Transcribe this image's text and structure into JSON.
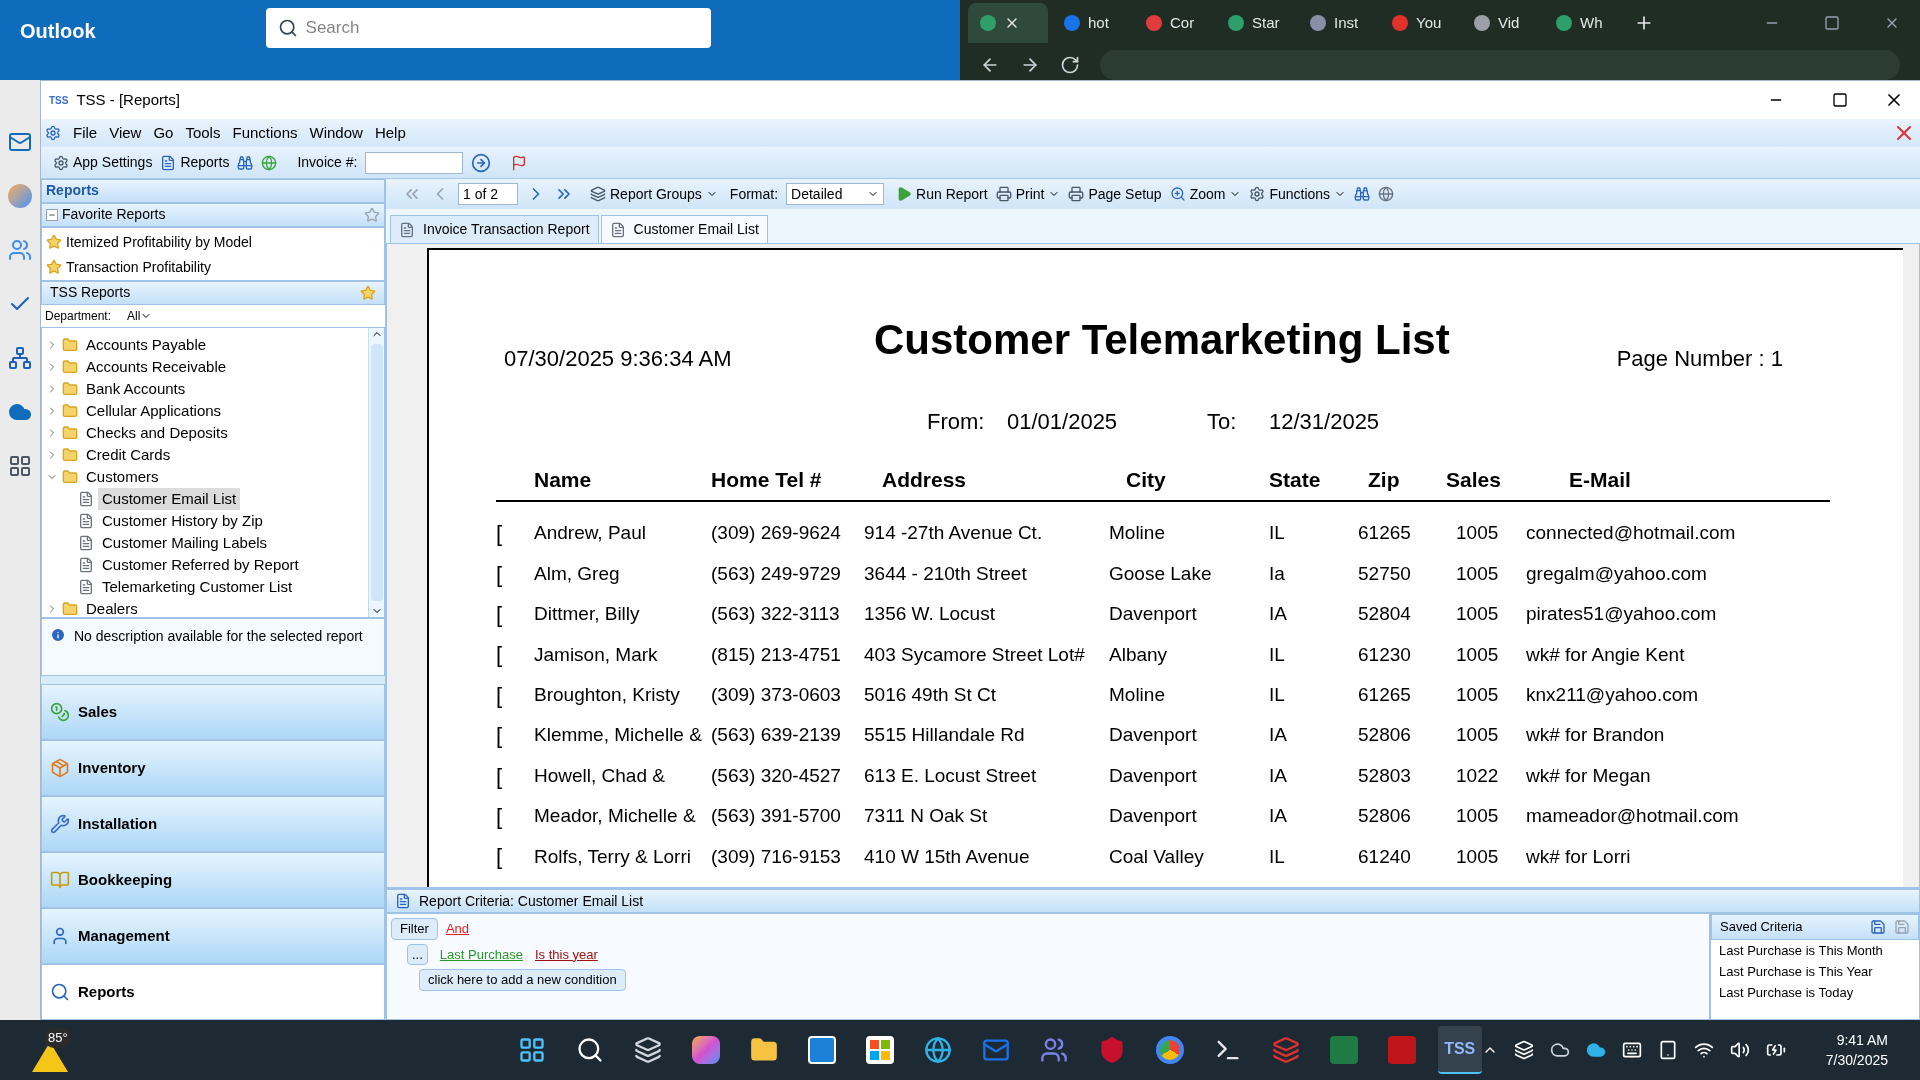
{
  "outlook": {
    "app_name": "Outlook",
    "search_placeholder": "Search"
  },
  "browser": {
    "tabs": [
      {
        "selected": true,
        "color": "#2e9e6b"
      },
      {
        "label": "hot",
        "selected": false,
        "color": "#1a73e8"
      },
      {
        "label": "Cor",
        "selected": false,
        "color": "#e03c3c"
      },
      {
        "label": "Star",
        "selected": false,
        "color": "#2e9e6b"
      },
      {
        "label": "Inst",
        "selected": false,
        "color": "#8a8fa8"
      },
      {
        "label": "You",
        "selected": false,
        "color": "#e0312b"
      },
      {
        "label": "Vid",
        "selected": false,
        "color": "#9aa0a6"
      },
      {
        "label": "Wh",
        "selected": false,
        "color": "#2e9e6b"
      }
    ]
  },
  "window": {
    "title": "TSS - [Reports]",
    "icon_text": "TSS"
  },
  "menu": [
    {
      "label": "File",
      "selected": false
    },
    {
      "label": "View",
      "selected": false
    },
    {
      "label": "Go",
      "selected": false
    },
    {
      "label": "Tools",
      "selected": false
    },
    {
      "label": "Functions",
      "selected": false
    },
    {
      "label": "Window",
      "selected": false
    },
    {
      "label": "Help",
      "selected": false
    }
  ],
  "toolbar": {
    "app_settings": "App Settings",
    "reports": "Reports",
    "invoice_label": "Invoice #:"
  },
  "report_toolbar": {
    "nav": [
      {
        "kind": "first",
        "disabled": true
      },
      {
        "kind": "prev",
        "disabled": true
      },
      {
        "kind": "page",
        "text": "1 of 2",
        "disabled": false
      },
      {
        "kind": "next",
        "disabled": false
      },
      {
        "kind": "last",
        "disabled": false
      }
    ],
    "report_groups": "Report Groups",
    "format_label": "Format:",
    "format_value": "Detailed",
    "run": "Run Report",
    "print": "Print",
    "page_setup": "Page Setup",
    "zoom": "Zoom",
    "functions": "Functions"
  },
  "tabs": [
    {
      "label": "Invoice Transaction Report",
      "selected": false
    },
    {
      "label": "Customer Email List",
      "selected": true
    }
  ],
  "sidebar": {
    "title": "Reports",
    "favorites_title": "Favorite Reports",
    "favorites_expanded": true,
    "favorites": [
      "Itemized Profitability by Model",
      "Transaction Profitability"
    ],
    "tss_title": "TSS Reports",
    "department_label": "Department:",
    "department_value": "All",
    "tree": [
      {
        "label": "Accounts Payable",
        "kind": "folder",
        "expanded": false,
        "selected": false
      },
      {
        "label": "Accounts Receivable",
        "kind": "folder",
        "expanded": false,
        "selected": false
      },
      {
        "label": "Bank Accounts",
        "kind": "folder",
        "expanded": false,
        "selected": false
      },
      {
        "label": "Cellular Applications",
        "kind": "folder",
        "expanded": false,
        "selected": false
      },
      {
        "label": "Checks and Deposits",
        "kind": "folder",
        "expanded": false,
        "selected": false
      },
      {
        "label": "Credit Cards",
        "kind": "folder",
        "expanded": false,
        "selected": false
      },
      {
        "label": "Customers",
        "kind": "folder",
        "expanded": true,
        "selected": false,
        "children": [
          {
            "label": "Customer Email List",
            "kind": "report",
            "selected": true
          },
          {
            "label": "Customer History by Zip",
            "kind": "report",
            "selected": false
          },
          {
            "label": "Customer Mailing Labels",
            "kind": "report",
            "selected": false
          },
          {
            "label": "Customer Referred by Report",
            "kind": "report",
            "selected": false
          },
          {
            "label": "Telemarketing Customer List",
            "kind": "report",
            "selected": false
          }
        ]
      },
      {
        "label": "Dealers",
        "kind": "folder",
        "expanded": false,
        "selected": false
      }
    ],
    "description": "No description available for the selected report",
    "nav": [
      {
        "label": "Sales",
        "kind": "sales",
        "selected": false
      },
      {
        "label": "Inventory",
        "kind": "inventory",
        "selected": false
      },
      {
        "label": "Installation",
        "kind": "installation",
        "selected": false
      },
      {
        "label": "Bookkeeping",
        "kind": "bookkeeping",
        "selected": false
      },
      {
        "label": "Management",
        "kind": "management",
        "selected": false
      },
      {
        "label": "Reports",
        "kind": "reports",
        "selected": true
      }
    ]
  },
  "report": {
    "printed_at": "07/30/2025 9:36:34 AM",
    "title": "Customer Telemarketing List",
    "page_number": "Page Number : 1",
    "from_label": "From:",
    "from": "01/01/2025",
    "to_label": "To:",
    "to": "12/31/2025",
    "columns": [
      "Name",
      "Home Tel #",
      "Address",
      "City",
      "State",
      "Zip",
      "Sales",
      "E-Mail"
    ],
    "rows": [
      {
        "mark": "[",
        "cells": [
          "Andrew, Paul",
          "(309) 269-9624",
          "914 -27th Avenue Ct.",
          "Moline",
          "IL",
          "61265",
          "1005",
          "connected@hotmail.com"
        ]
      },
      {
        "mark": "[",
        "cells": [
          "Alm, Greg",
          "(563) 249-9729",
          "3644 - 210th Street",
          "Goose Lake",
          "Ia",
          "52750",
          "1005",
          "gregalm@yahoo.com"
        ]
      },
      {
        "mark": "[",
        "cells": [
          "Dittmer, Billy",
          "(563) 322-3113",
          "1356 W. Locust",
          "Davenport",
          "IA",
          "52804",
          "1005",
          "pirates51@yahoo.com"
        ]
      },
      {
        "mark": "[",
        "cells": [
          "Jamison, Mark",
          "(815) 213-4751",
          "403 Sycamore Street Lot#",
          "Albany",
          "IL",
          "61230",
          "1005",
          "wk# for Angie Kent"
        ]
      },
      {
        "mark": "[",
        "cells": [
          "Broughton, Kristy",
          "(309) 373-0603",
          "5016 49th St Ct",
          "Moline",
          "IL",
          "61265",
          "1005",
          "knx211@yahoo.com"
        ]
      },
      {
        "mark": "[",
        "cells": [
          "Klemme, Michelle &",
          "(563) 639-2139",
          "5515 Hillandale Rd",
          "Davenport",
          "IA",
          "52806",
          "1005",
          "wk# for Brandon"
        ]
      },
      {
        "mark": "[",
        "cells": [
          "Howell, Chad &",
          "(563) 320-4527",
          "613 E. Locust Street",
          "Davenport",
          "IA",
          "52803",
          "1022",
          "wk# for Megan"
        ]
      },
      {
        "mark": "[",
        "cells": [
          "Meador, Michelle &",
          "(563) 391-5700",
          "7311 N Oak St",
          "Davenport",
          "IA",
          "52806",
          "1005",
          "mameador@hotmail.com"
        ]
      },
      {
        "mark": "[",
        "cells": [
          "Rolfs, Terry & Lorri",
          "(309) 716-9153",
          "410 W 15th Avenue",
          "Coal Valley",
          "IL",
          "61240",
          "1005",
          "wk# for Lorri"
        ]
      }
    ]
  },
  "criteria": {
    "title": "Report Criteria: Customer Email List",
    "filter": "Filter",
    "operator": "And",
    "more": "...",
    "field": "Last Purchase",
    "condition": "Is this year",
    "add": "click here to add a new condition",
    "saved_title": "Saved Criteria",
    "saved": [
      "Last Purchase is This Month",
      "Last Purchase is This Year",
      "Last Purchase is Today"
    ]
  },
  "taskbar": {
    "weather": "85°",
    "apps": [
      {
        "kind": "start",
        "selected": false
      },
      {
        "kind": "search",
        "selected": false
      },
      {
        "kind": "taskview",
        "selected": false
      },
      {
        "kind": "copilot",
        "selected": false
      },
      {
        "kind": "explorer",
        "selected": false
      },
      {
        "kind": "rapp",
        "selected": false
      },
      {
        "kind": "store",
        "selected": false
      },
      {
        "kind": "edge",
        "selected": false
      },
      {
        "kind": "outlook",
        "selected": false
      },
      {
        "kind": "teams",
        "selected": false
      },
      {
        "kind": "shield",
        "selected": false
      },
      {
        "kind": "chrome",
        "selected": false
      },
      {
        "kind": "terminal",
        "selected": false
      },
      {
        "kind": "windows",
        "selected": false
      },
      {
        "kind": "excel",
        "selected": false
      },
      {
        "kind": "pdf",
        "selected": false
      },
      {
        "kind": "tss",
        "selected": true,
        "text": "TSS"
      }
    ],
    "time": "9:41 AM",
    "date": "7/30/2025"
  }
}
